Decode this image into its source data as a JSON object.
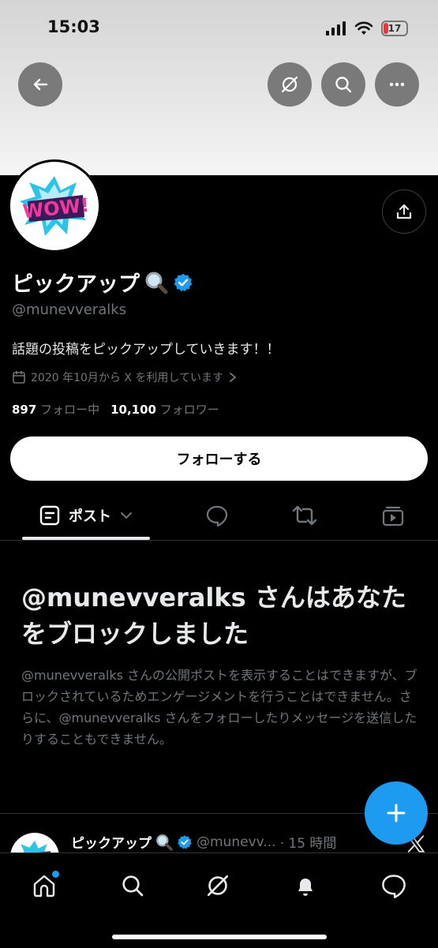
{
  "status_bar": {
    "time": "15:03",
    "battery_level": "17"
  },
  "profile": {
    "avatar_text": "WOW!",
    "display_name": "ピックアップ",
    "handle": "@munevveralks",
    "bio": "話題の投稿をピックアップしていきます！！",
    "joined": "2020 年10月から X を利用しています",
    "following_count": "897",
    "following_label": "フォロー中",
    "followers_count": "10,100",
    "followers_label": "フォロワー",
    "follow_button": "フォローする"
  },
  "tabs": {
    "post_label": "ポスト"
  },
  "blocked": {
    "title": "@munevveralks さんはあなたをブロックしました",
    "body": "@munevveralks さんの公開ポストを表示することはできますが、ブロックされているためエンゲージメントを行うことはできません。さらに、@munevveralks さんをフォローしたりメッセージを送信したりすることもできません。"
  },
  "post_preview": {
    "name": "ピックアップ",
    "handle": "@munevv...",
    "time": "· 15 時間"
  },
  "colors": {
    "accent": "#1d9bf0",
    "background": "#000000",
    "muted": "#71767b"
  }
}
